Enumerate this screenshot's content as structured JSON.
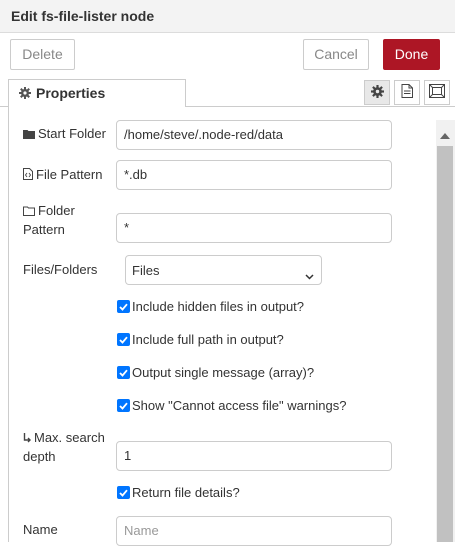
{
  "dialog": {
    "title": "Edit fs-file-lister node",
    "delete_label": "Delete",
    "cancel_label": "Cancel",
    "done_label": "Done"
  },
  "tabs": {
    "properties_label": "Properties",
    "icons": [
      "gear-icon",
      "description-icon",
      "appearance-icon"
    ]
  },
  "form": {
    "start_folder": {
      "label": "Start Folder",
      "icon": "folder-icon",
      "value": "/home/steve/.node-red/data"
    },
    "file_pattern": {
      "label": "File Pattern",
      "icon": "file-code-icon",
      "value": "*.db"
    },
    "folder_pattern": {
      "label_line1": "Folder",
      "label_line2": "Pattern",
      "icon": "folder-outline-icon",
      "value": "*"
    },
    "files_folders": {
      "label": "Files/Folders",
      "selected": "Files"
    },
    "checkboxes": [
      {
        "label": "Include hidden files in output?",
        "checked": true
      },
      {
        "label": "Include full path in output?",
        "checked": true
      },
      {
        "label": "Output single message (array)?",
        "checked": true
      },
      {
        "label": "Show \"Cannot access file\" warnings?",
        "checked": true
      }
    ],
    "max_depth": {
      "label_line1": "Max. search",
      "label_line2": "depth",
      "icon": "arrow-down-right-icon",
      "value": "1"
    },
    "return_details": {
      "label": "Return file details?",
      "checked": true
    },
    "name": {
      "label": "Name",
      "placeholder": "Name",
      "value": ""
    }
  },
  "colors": {
    "accent": "#ad1625",
    "checkbox": "#0075ff"
  }
}
